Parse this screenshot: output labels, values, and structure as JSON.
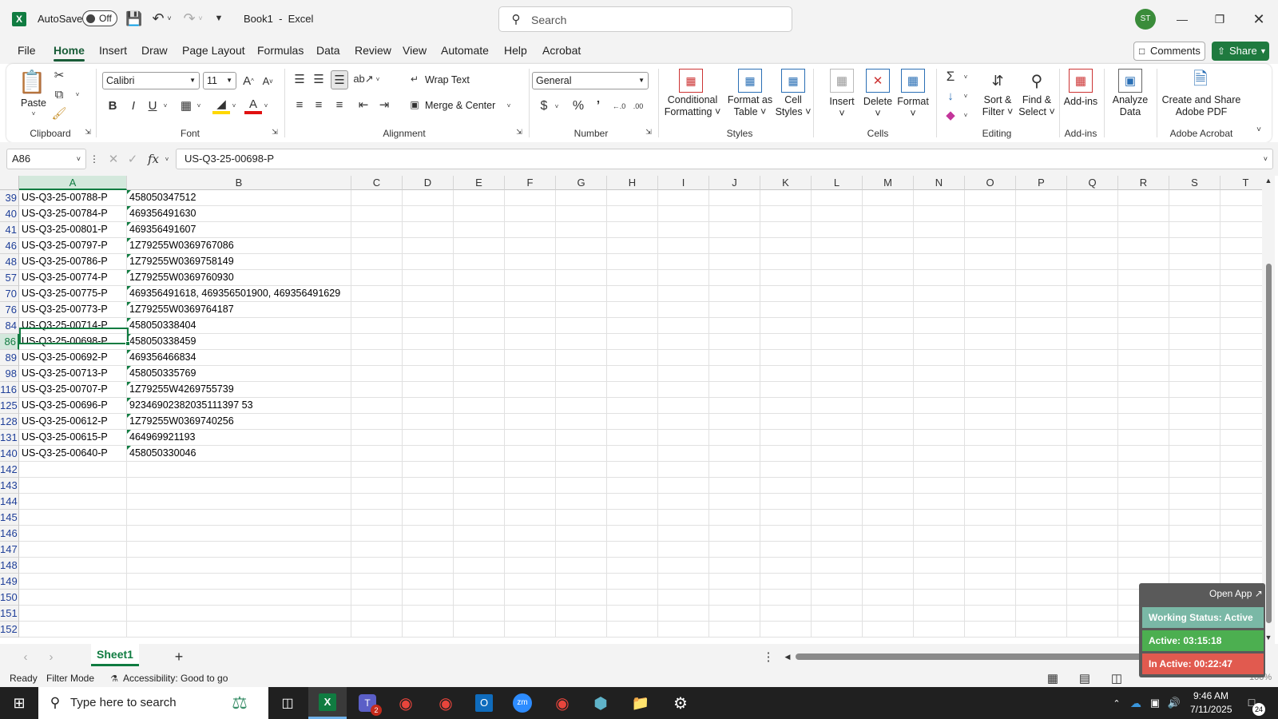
{
  "titlebar": {
    "autosave_label": "AutoSave",
    "toggle_state": "Off",
    "document_title": "Book1  -  Excel",
    "search_placeholder": "Search",
    "avatar_initials": "ST"
  },
  "tabs": [
    "File",
    "Home",
    "Insert",
    "Draw",
    "Page Layout",
    "Formulas",
    "Data",
    "Review",
    "View",
    "Automate",
    "Help",
    "Acrobat"
  ],
  "buttons": {
    "comments": "Comments",
    "share": "Share"
  },
  "ribbon": {
    "paste": "Paste",
    "clipboard": "Clipboard",
    "font_name": "Calibri",
    "font_size": "11",
    "font": "Font",
    "wrap_text": "Wrap Text",
    "merge_center": "Merge & Center",
    "alignment": "Alignment",
    "number_format": "General",
    "number": "Number",
    "cond_fmt_1": "Conditional",
    "cond_fmt_2": "Formatting",
    "fmt_table_1": "Format as",
    "fmt_table_2": "Table",
    "cell_styles_1": "Cell",
    "cell_styles_2": "Styles",
    "styles": "Styles",
    "insert": "Insert",
    "delete": "Delete",
    "format": "Format",
    "cells": "Cells",
    "sort_1": "Sort &",
    "sort_2": "Filter",
    "find_1": "Find &",
    "find_2": "Select",
    "editing": "Editing",
    "addins": "Add-ins",
    "addins_grp": "Add-ins",
    "analyze_1": "Analyze",
    "analyze_2": "Data",
    "create_pdf_1": "Create and Share",
    "create_pdf_2": "Adobe PDF",
    "acrobat_grp": "Adobe Acrobat"
  },
  "formula_bar": {
    "name_box": "A86",
    "fx": "fx",
    "value": "US-Q3-25-00698-P"
  },
  "columns": [
    "A",
    "B",
    "C",
    "D",
    "E",
    "F",
    "G",
    "H",
    "I",
    "J",
    "K",
    "L",
    "M",
    "N",
    "O",
    "P",
    "Q",
    "R",
    "S",
    "T"
  ],
  "rows": [
    {
      "n": "39",
      "a": "US-Q3-25-00788-P",
      "b": "458050347512"
    },
    {
      "n": "40",
      "a": "US-Q3-25-00784-P",
      "b": "469356491630"
    },
    {
      "n": "41",
      "a": "US-Q3-25-00801-P",
      "b": "469356491607"
    },
    {
      "n": "46",
      "a": "US-Q3-25-00797-P",
      "b": "1Z79255W0369767086"
    },
    {
      "n": "48",
      "a": "US-Q3-25-00786-P",
      "b": "1Z79255W0369758149"
    },
    {
      "n": "57",
      "a": "US-Q3-25-00774-P",
      "b": "1Z79255W0369760930"
    },
    {
      "n": "70",
      "a": "US-Q3-25-00775-P",
      "b": "469356491618, 469356501900, 469356491629"
    },
    {
      "n": "76",
      "a": "US-Q3-25-00773-P",
      "b": "1Z79255W0369764187"
    },
    {
      "n": "84",
      "a": "US-Q3-25-00714-P",
      "b": "458050338404"
    },
    {
      "n": "86",
      "a": "US-Q3-25-00698-P",
      "b": "458050338459"
    },
    {
      "n": "89",
      "a": "US-Q3-25-00692-P",
      "b": "469356466834"
    },
    {
      "n": "98",
      "a": "US-Q3-25-00713-P",
      "b": "458050335769"
    },
    {
      "n": "116",
      "a": "US-Q3-25-00707-P",
      "b": "1Z79255W4269755739"
    },
    {
      "n": "125",
      "a": "US-Q3-25-00696-P",
      "b": "92346902382035111397 53"
    },
    {
      "n": "128",
      "a": "US-Q3-25-00612-P",
      "b": "1Z79255W0369740256"
    },
    {
      "n": "131",
      "a": "US-Q3-25-00615-P",
      "b": "464969921193"
    },
    {
      "n": "140",
      "a": "US-Q3-25-00640-P",
      "b": "458050330046"
    },
    {
      "n": "142",
      "a": "",
      "b": ""
    },
    {
      "n": "143",
      "a": "",
      "b": ""
    },
    {
      "n": "144",
      "a": "",
      "b": ""
    },
    {
      "n": "145",
      "a": "",
      "b": ""
    },
    {
      "n": "146",
      "a": "",
      "b": ""
    },
    {
      "n": "147",
      "a": "",
      "b": ""
    },
    {
      "n": "148",
      "a": "",
      "b": ""
    },
    {
      "n": "149",
      "a": "",
      "b": ""
    },
    {
      "n": "150",
      "a": "",
      "b": ""
    },
    {
      "n": "151",
      "a": "",
      "b": ""
    },
    {
      "n": "152",
      "a": "",
      "b": ""
    }
  ],
  "sheet": {
    "tab": "Sheet1"
  },
  "status": {
    "ready": "Ready",
    "filter": "Filter Mode",
    "accessibility": "Accessibility: Good to go",
    "zoom": "100%"
  },
  "overlay": {
    "open_app": "Open App ↗",
    "working": "Working Status: Active",
    "active": "Active: 03:15:18",
    "inactive": "In Active: 00:22:47"
  },
  "taskbar": {
    "search_placeholder": "Type here to search",
    "time": "9:46 AM",
    "date": "7/11/2025",
    "notif": "24",
    "teams_badge": "2"
  },
  "colors": {
    "excel_green": "#107c41",
    "share_green": "#1f7a3f",
    "active_green": "#4caf50",
    "inactive_red": "#e15a4f"
  }
}
